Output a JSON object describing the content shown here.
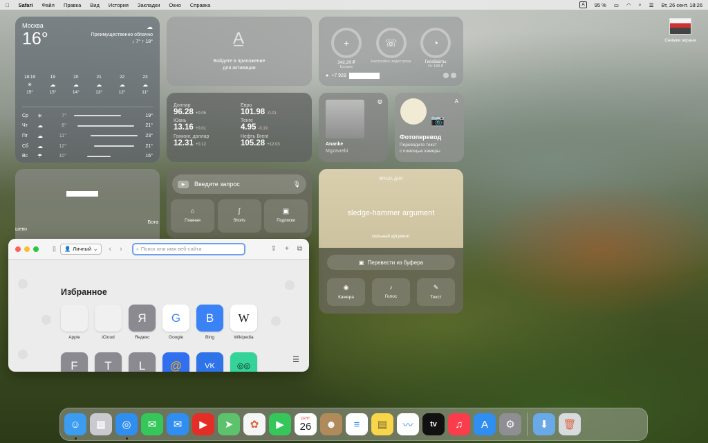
{
  "menubar": {
    "app": "Safari",
    "items": [
      "Файл",
      "Правка",
      "Вид",
      "История",
      "Закладки",
      "Окно",
      "Справка"
    ],
    "battery": "95 %",
    "kbd": "A",
    "datetime": "Вт, 26 сент. 18:26"
  },
  "weather": {
    "city": "Москва",
    "temp": "16°",
    "condition": "Преимущественно облачно",
    "range": "↓ 7° ↑ 18°",
    "hourly": [
      {
        "t": "18:19",
        "icon": "☀",
        "v": "15°"
      },
      {
        "t": "19",
        "icon": "☁",
        "v": "15°"
      },
      {
        "t": "20",
        "icon": "☁",
        "v": "14°"
      },
      {
        "t": "21",
        "icon": "☁",
        "v": "13°"
      },
      {
        "t": "22",
        "icon": "☁",
        "v": "12°"
      },
      {
        "t": "23",
        "icon": "☁",
        "v": "11°"
      }
    ],
    "daily": [
      {
        "d": "Ср",
        "icon": "☀",
        "lo": "7°",
        "hi": "19°",
        "bar": [
          0.05,
          0.75
        ]
      },
      {
        "d": "Чт",
        "icon": "☁",
        "lo": "8°",
        "hi": "21°",
        "bar": [
          0.1,
          0.95
        ]
      },
      {
        "d": "Пт",
        "icon": "☁",
        "lo": "11°",
        "hi": "23°",
        "bar": [
          0.3,
          1.0
        ]
      },
      {
        "d": "Сб",
        "icon": "☁",
        "lo": "12°",
        "hi": "21°",
        "bar": [
          0.35,
          0.95
        ]
      },
      {
        "d": "Вс",
        "icon": "☂",
        "lo": "10°",
        "hi": "16°",
        "bar": [
          0.25,
          0.6
        ]
      }
    ]
  },
  "appstore": {
    "text1": "Войдите в приложение",
    "text2": "для активации"
  },
  "mobile": {
    "items": [
      {
        "icon": "+",
        "v": "342,20 ₽",
        "s": "Баланс"
      },
      {
        "icon": "☏",
        "v": "",
        "s": "Настройка недоступна"
      },
      {
        "icon": "◔",
        "v": "Гигабайты",
        "s": "От 188 ₽"
      }
    ],
    "phone": "+7 928"
  },
  "rates": [
    {
      "nm": "Доллар",
      "val": "96.28",
      "ch": "+0.05",
      "chc": "#c9d7c0"
    },
    {
      "nm": "Евро",
      "val": "101.98",
      "ch": "-0.01",
      "chc": "#e7c2b5"
    },
    {
      "nm": "Юань",
      "val": "13.16",
      "ch": "+0.01",
      "chc": "#c9d7c0"
    },
    {
      "nm": "Тенге",
      "val": "4.95",
      "ch": "-0.19",
      "chc": "#e7c2b5"
    },
    {
      "nm": "Гонконг. доллар",
      "val": "12.31",
      "ch": "+0.12",
      "chc": "#c9d7c0"
    },
    {
      "nm": "Нефть Brent",
      "val": "105.28",
      "ch": "+12.03",
      "chc": "#c9d7c0"
    }
  ],
  "photo": {
    "title": "Ananke",
    "sub": "Mgzavrebi"
  },
  "fototr": {
    "title": "Фотоперевод",
    "sub1": "Переводите текст",
    "sub2": "с помощью камеры"
  },
  "map": {
    "label1": "шево",
    "label2": "Бота"
  },
  "youtube": {
    "placeholder": "Введите запрос",
    "buttons": [
      {
        "icon": "⌂",
        "label": "Главная"
      },
      {
        "icon": "∫",
        "label": "Shorts"
      },
      {
        "icon": "▣",
        "label": "Подписки"
      }
    ]
  },
  "phrase": {
    "label": "ФРАЗА ДНЯ",
    "text": "sledge-hammer argument",
    "translation": "сильный аргумент",
    "buffer": "Перевести из буфера",
    "buttons": [
      {
        "icon": "◉",
        "label": "Камера"
      },
      {
        "icon": "♪",
        "label": "Голос"
      },
      {
        "icon": "✎",
        "label": "Текст"
      }
    ]
  },
  "safari": {
    "profile": "Личный",
    "url_placeholder": "Поиск или имя веб-сайта",
    "favorites_title": "Избранное",
    "favorites": [
      {
        "glyph": "",
        "label": "Apple",
        "bg": "#f0f0f0",
        "fg": "#666"
      },
      {
        "glyph": "",
        "label": "iCloud",
        "bg": "#f0f0f0",
        "fg": "#666"
      },
      {
        "glyph": "Я",
        "label": "Яндекс",
        "bg": "#8a8a90",
        "fg": "#fff"
      },
      {
        "glyph": "G",
        "label": "Google",
        "bg": "#ffffff",
        "fg": "#4285F4"
      },
      {
        "glyph": "B",
        "label": "Bing",
        "bg": "#3b82f6",
        "fg": "#fff"
      },
      {
        "glyph": "W",
        "label": "Wikipedia",
        "bg": "#ffffff",
        "fg": "#111"
      }
    ],
    "favorites2": [
      {
        "glyph": "F",
        "bg": "#8a8a90",
        "fg": "#fff"
      },
      {
        "glyph": "T",
        "bg": "#8a8a90",
        "fg": "#fff"
      },
      {
        "glyph": "L",
        "bg": "#8a8a90",
        "fg": "#fff"
      },
      {
        "glyph": "@",
        "bg": "#2f6ff0",
        "fg": "#ffb000"
      },
      {
        "glyph": "VK",
        "bg": "#2e73e8",
        "fg": "#fff"
      },
      {
        "glyph": "◎◎",
        "bg": "#34d399",
        "fg": "#111"
      }
    ]
  },
  "desktop": {
    "screenshots": "Снимки экрана"
  },
  "dock": [
    {
      "n": "finder",
      "g": "☺",
      "bg": "#3b9cf0",
      "dot": true
    },
    {
      "n": "launchpad",
      "g": "▦",
      "bg": "#c9c9cf"
    },
    {
      "n": "safari",
      "g": "◎",
      "bg": "#2f8ef0",
      "dot": true
    },
    {
      "n": "messages",
      "g": "✉",
      "bg": "#35c759"
    },
    {
      "n": "mail",
      "g": "✉",
      "bg": "#2f8ef0"
    },
    {
      "n": "youtube",
      "g": "▶",
      "bg": "#e52d27"
    },
    {
      "n": "maps",
      "g": "➤",
      "bg": "#5cc26b"
    },
    {
      "n": "photos",
      "g": "✿",
      "bg": "#f5f5f5"
    },
    {
      "n": "facetime",
      "g": "▶",
      "bg": "#35c759"
    },
    {
      "n": "calendar",
      "g": "26",
      "bg": "#ffffff"
    },
    {
      "n": "contacts",
      "g": "☻",
      "bg": "#b08a5a"
    },
    {
      "n": "reminders",
      "g": "≡",
      "bg": "#ffffff"
    },
    {
      "n": "notes",
      "g": "▤",
      "bg": "#f9d54a"
    },
    {
      "n": "freeform",
      "g": "〰",
      "bg": "#ffffff"
    },
    {
      "n": "tv",
      "g": "tv",
      "bg": "#111111"
    },
    {
      "n": "music",
      "g": "♫",
      "bg": "#fa3c4c"
    },
    {
      "n": "appstore",
      "g": "A",
      "bg": "#2f8ef0"
    },
    {
      "n": "settings",
      "g": "⚙",
      "bg": "#8e8e93"
    },
    {
      "n": "downloads",
      "g": "⬇",
      "bg": "#6aa9e8"
    },
    {
      "n": "trash",
      "g": "🗑",
      "bg": "#d7dbe0"
    }
  ],
  "calendar_month": "СЕНТ."
}
